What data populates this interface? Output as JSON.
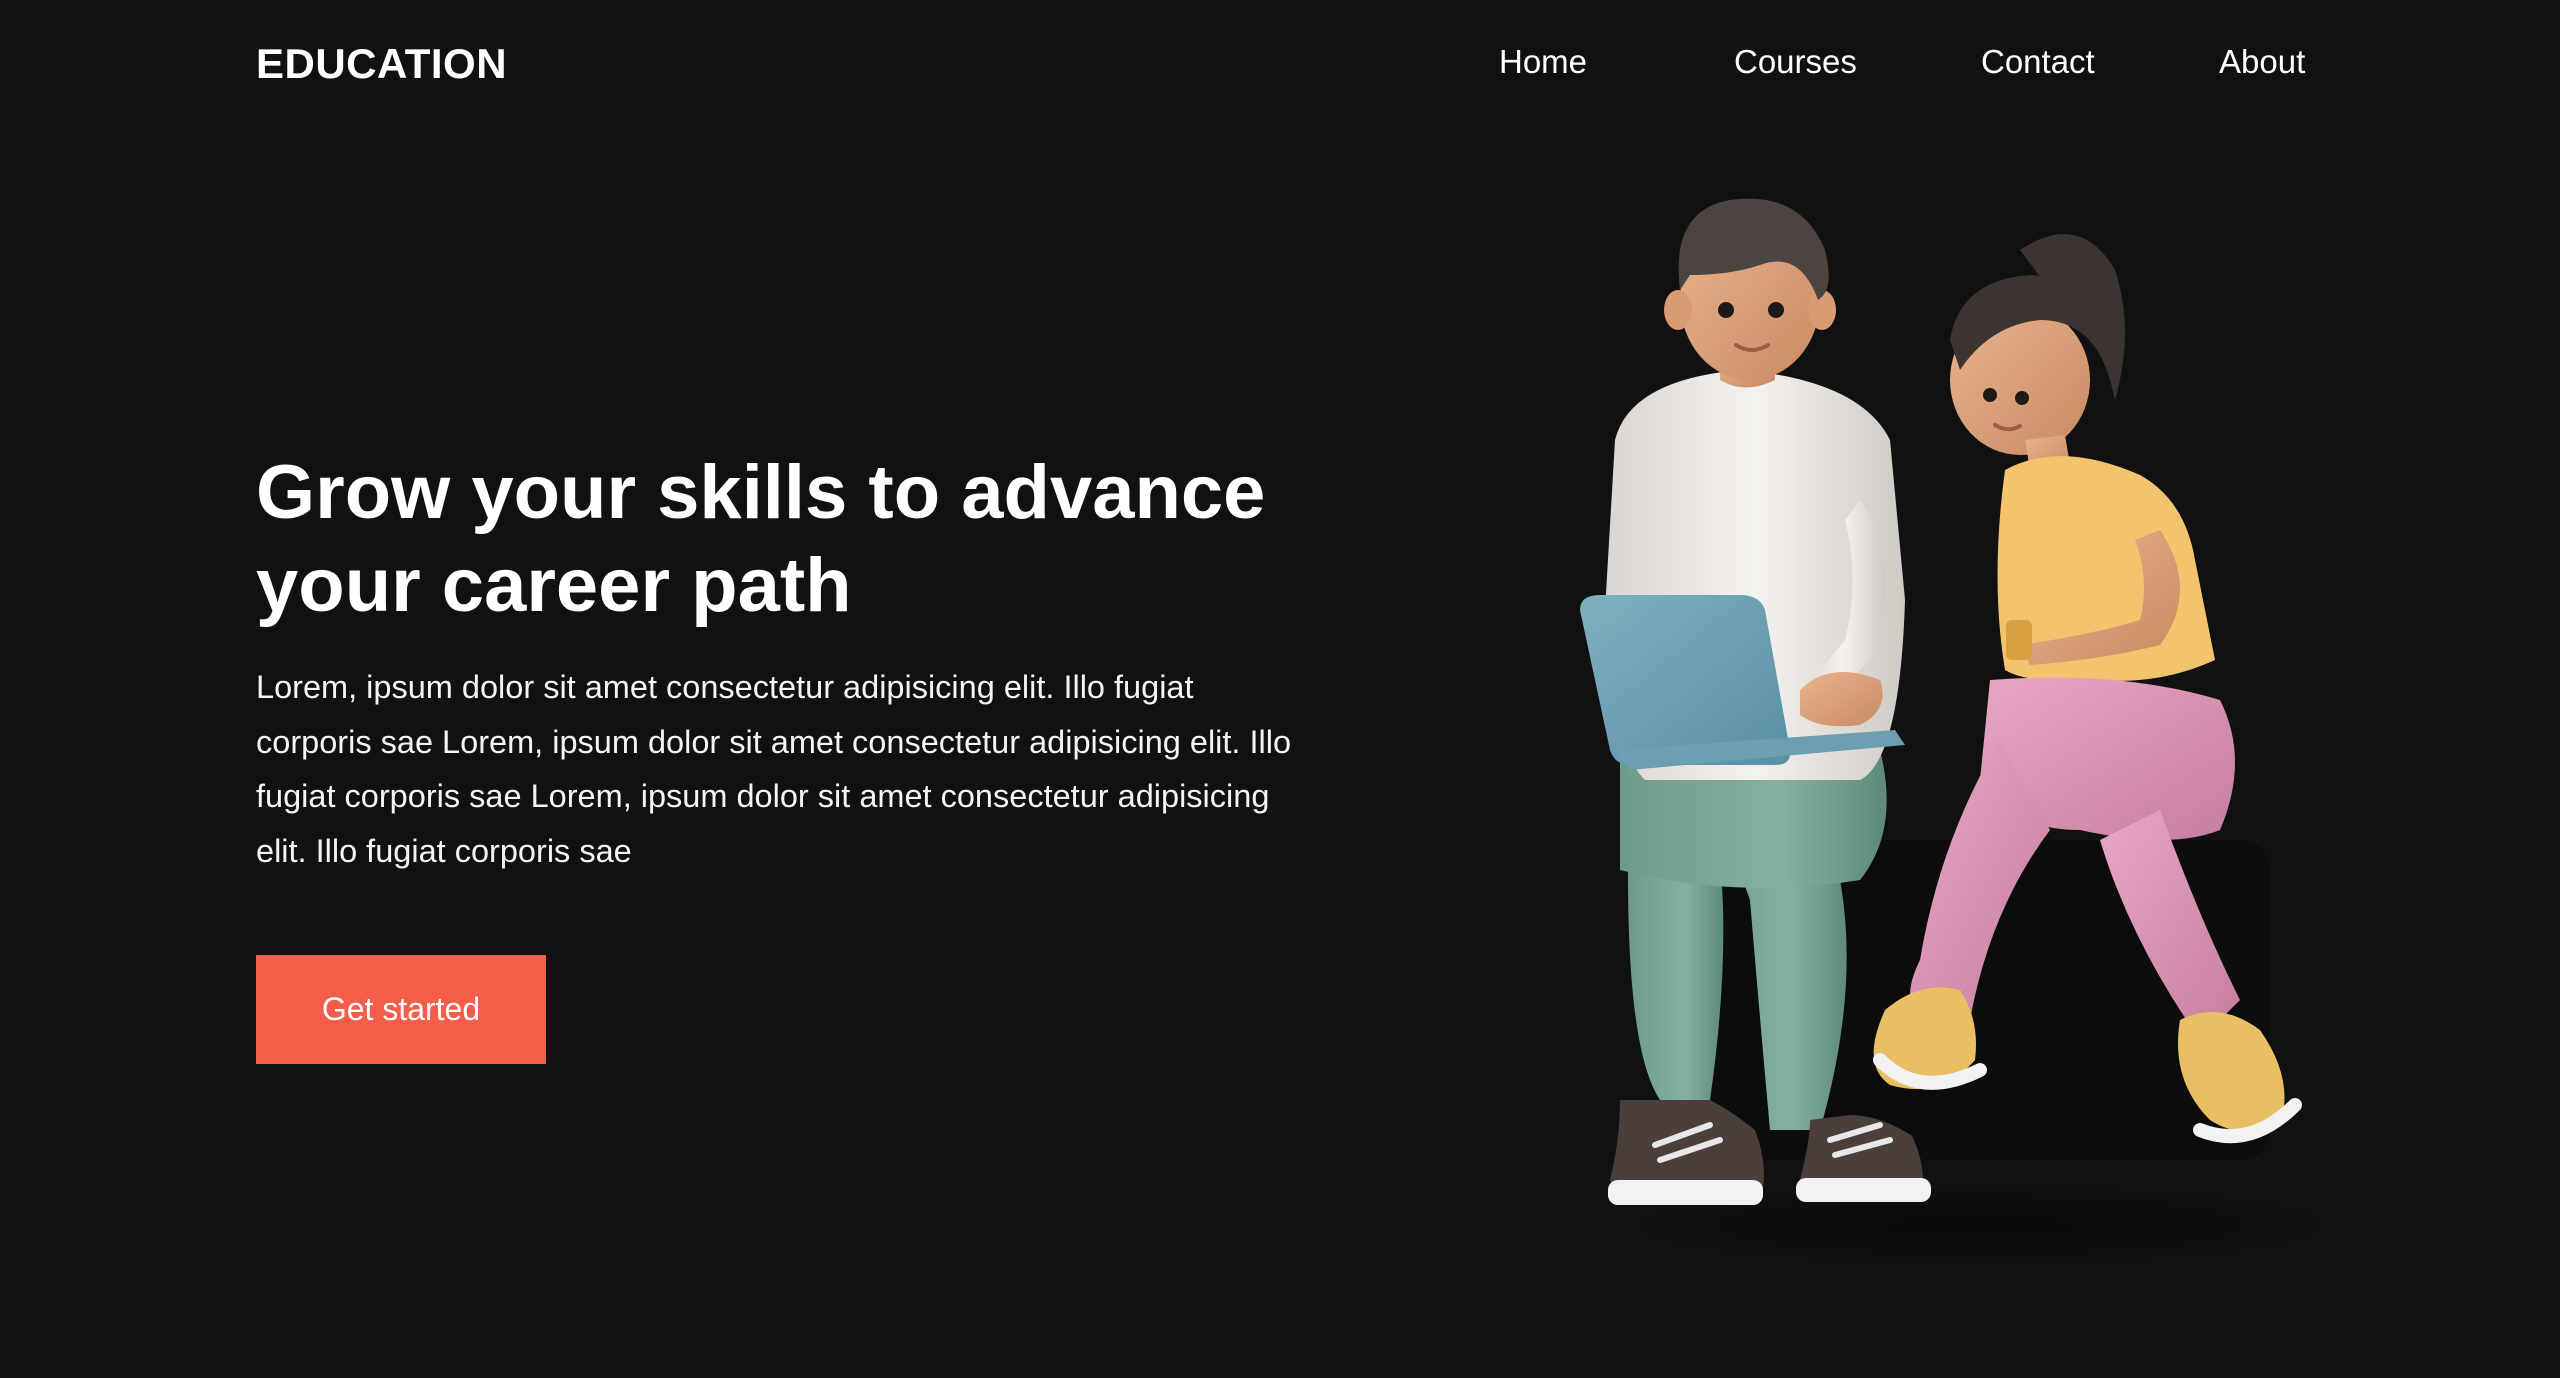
{
  "nav": {
    "logo": "EDUCATION",
    "links": [
      "Home",
      "Courses",
      "Contact",
      "About"
    ]
  },
  "hero": {
    "title": "Grow your skills to advance your career path",
    "body": "Lorem, ipsum dolor sit amet consectetur adipisicing elit. Illo fugiat corporis sae Lorem, ipsum dolor sit amet consectetur adipisicing elit. Illo fugiat corporis sae Lorem, ipsum dolor sit amet consectetur adipisicing elit. Illo fugiat corporis sae",
    "cta_label": "Get started"
  },
  "colors": {
    "background": "#111111",
    "accent": "#f35d4a",
    "text": "#ffffff"
  },
  "illustration": {
    "icon": "two-people-with-laptop-illustration"
  }
}
